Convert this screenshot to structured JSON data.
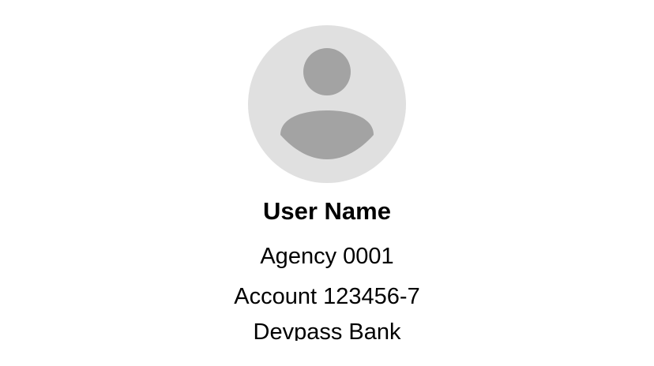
{
  "profile": {
    "avatar_icon": "user-placeholder-icon",
    "name": "User Name",
    "agency": "Agency 0001",
    "account": "Account 123456-7",
    "bank": "Devpass Bank"
  },
  "colors": {
    "avatar_background": "#e0e0e0",
    "avatar_figure": "#a3a3a3",
    "text": "#000000",
    "page_background": "#ffffff"
  }
}
